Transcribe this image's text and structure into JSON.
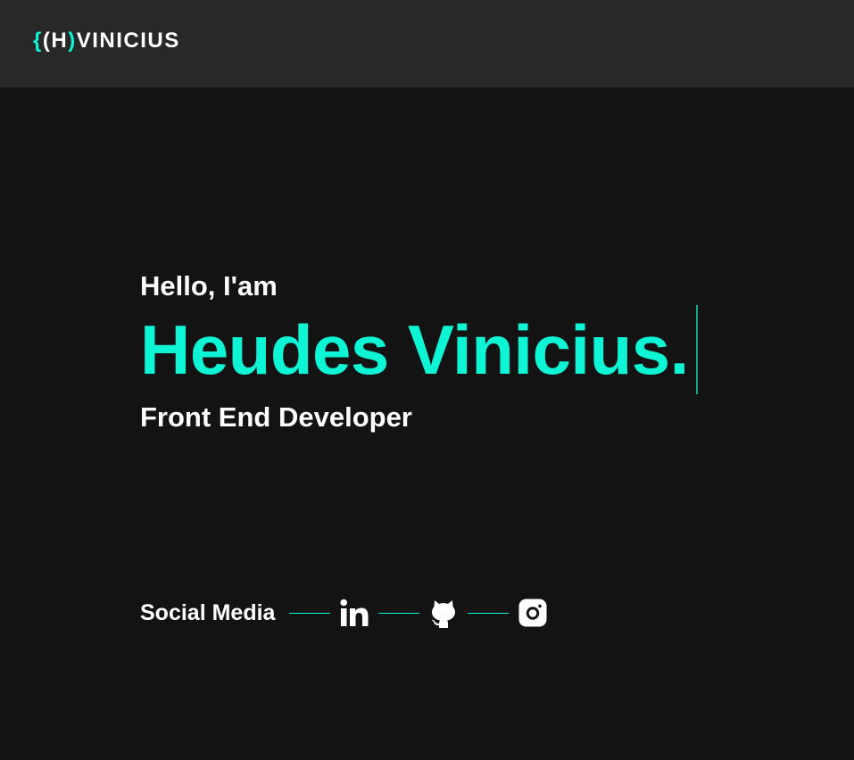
{
  "header": {
    "logo": {
      "brace_open": "{",
      "letter": "H",
      "brace_close": ")",
      "paren_open": "(",
      "name": "VINICIUS"
    }
  },
  "hero": {
    "greeting": "Hello, I'am",
    "name": "Heudes Vinicius.",
    "role": "Front End Developer"
  },
  "social": {
    "label": "Social Media",
    "links": [
      {
        "icon": "linkedin-icon"
      },
      {
        "icon": "github-icon"
      },
      {
        "icon": "instagram-icon"
      }
    ]
  },
  "colors": {
    "accent": "#0ef5d6",
    "background": "#141314",
    "header_background": "#282828",
    "text": "#ffffff"
  }
}
